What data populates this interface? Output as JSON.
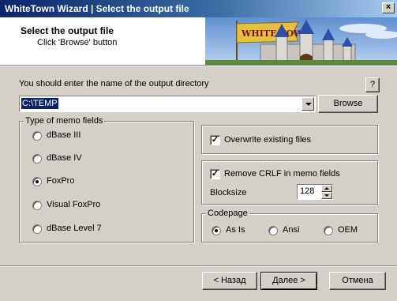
{
  "window": {
    "title": "WhiteTown Wizard | Select the output file",
    "close_glyph": "×"
  },
  "header": {
    "title": "Select the output file",
    "subtitle": "Click 'Browse' button",
    "banner_text": "WHITE TOWN"
  },
  "output": {
    "prompt": "You should enter the name of the output directory",
    "help_label": "?",
    "path_value": "C:\\TEMP",
    "browse_label": "Browse"
  },
  "memo_group": {
    "title": "Type of memo fields",
    "options": [
      {
        "label": "dBase III",
        "selected": false
      },
      {
        "label": "dBase IV",
        "selected": false
      },
      {
        "label": "FoxPro",
        "selected": true
      },
      {
        "label": "Visual FoxPro",
        "selected": false
      },
      {
        "label": "dBase Level 7",
        "selected": false
      }
    ]
  },
  "overwrite": {
    "label": "Overwrite existing files",
    "checked": true
  },
  "crlf": {
    "label": "Remove CRLF in memo fields",
    "checked": true,
    "blocksize_label": "Blocksize",
    "blocksize_value": "128"
  },
  "codepage": {
    "title": "Codepage",
    "options": [
      {
        "label": "As Is",
        "selected": true
      },
      {
        "label": "Ansi",
        "selected": false
      },
      {
        "label": "OEM",
        "selected": false
      }
    ]
  },
  "footer": {
    "back_label": "< Назад",
    "next_label": "Далее >",
    "cancel_label": "Отмена"
  }
}
